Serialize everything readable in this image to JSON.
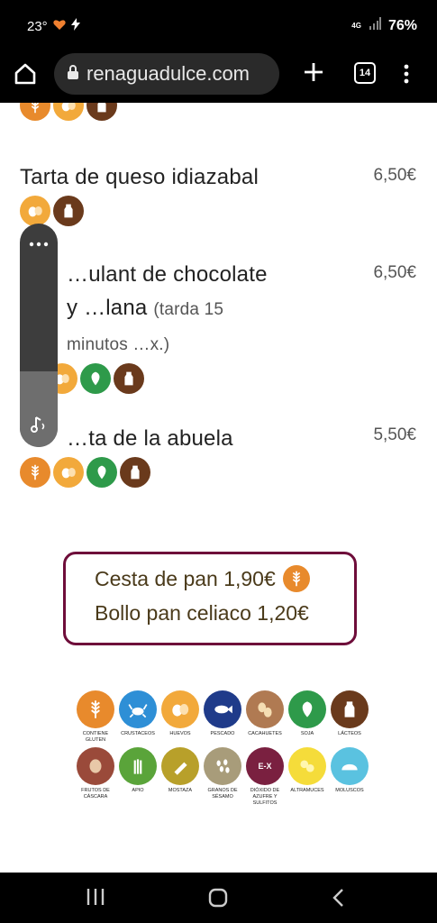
{
  "status": {
    "temperature": "23°",
    "network": "4G",
    "battery": "76%"
  },
  "browser": {
    "url": "renaguadulce.com",
    "tab_count": "14"
  },
  "menu": {
    "items": [
      {
        "name": "Tarta de queso idiazabal",
        "price": "6,50€"
      },
      {
        "name": "…ulant de chocolate y …lana",
        "note": "(tarda 15 minutos …x.)",
        "price": "6,50€"
      },
      {
        "name": "…ta de la abuela",
        "price": "5,50€"
      }
    ]
  },
  "bread": {
    "line1": "Cesta de pan 1,90€",
    "line2": "Bollo pan celiaco 1,20€"
  },
  "legend": {
    "row1": [
      {
        "label": "CONTIENE GLUTEN",
        "color": "#e88a2c",
        "icon": "wheat-icon"
      },
      {
        "label": "CRUSTACEOS",
        "color": "#2e8fd6",
        "icon": "crab-icon"
      },
      {
        "label": "HUEVOS",
        "color": "#f2a93b",
        "icon": "egg-icon"
      },
      {
        "label": "PESCADO",
        "color": "#1f3b8a",
        "icon": "fish-icon"
      },
      {
        "label": "CACAHUETES",
        "color": "#b07a52",
        "icon": "peanut-icon"
      },
      {
        "label": "SOJA",
        "color": "#2e9a4a",
        "icon": "soy-icon"
      },
      {
        "label": "LÁCTEOS",
        "color": "#6a3a1c",
        "icon": "milk-icon"
      }
    ],
    "row2": [
      {
        "label": "FRUTOS DE CÁSCARA",
        "color": "#9a4a3a",
        "icon": "nut-icon"
      },
      {
        "label": "APIO",
        "color": "#5aa43a",
        "icon": "celery-icon"
      },
      {
        "label": "MOSTAZA",
        "color": "#b8a02a",
        "icon": "mustard-icon"
      },
      {
        "label": "GRANOS DE SÉSAMO",
        "color": "#a89c7a",
        "icon": "sesame-icon"
      },
      {
        "label": "DIÓXIDO DE AZUFRE Y SULFITOS",
        "color": "#7a2040",
        "icon": "sulphite-icon",
        "badge": "E-X"
      },
      {
        "label": "ALTRAMUCES",
        "color": "#f5dc3a",
        "icon": "lupin-icon"
      },
      {
        "label": "MOLUSCOS",
        "color": "#5ac2e0",
        "icon": "shell-icon"
      }
    ]
  }
}
